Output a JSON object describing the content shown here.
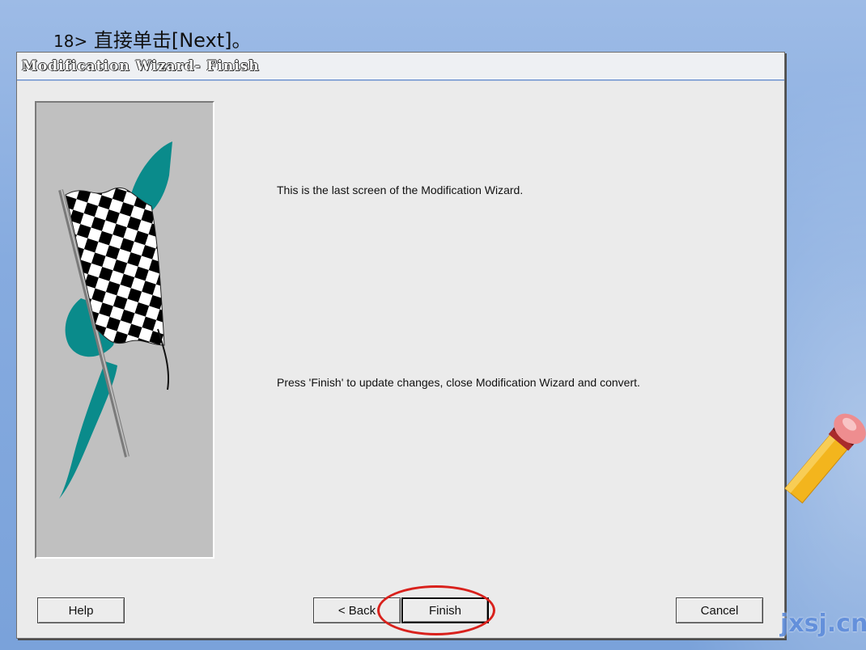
{
  "slide": {
    "step": "18>",
    "caption": "直接单击[Next]。"
  },
  "dialog": {
    "title": "Modification Wizard- Finish",
    "message_1": "This is the last screen of the Modification Wizard.",
    "message_2": "Press 'Finish' to update changes, close Modification Wizard and convert.",
    "image_icon": "checkered-flag"
  },
  "buttons": {
    "help": "Help",
    "back": "< Back",
    "finish": "Finish",
    "cancel": "Cancel"
  },
  "watermark": "jxsj.cn",
  "colors": {
    "highlight": "#d9211c",
    "flag_accent": "#0a8b8b"
  }
}
